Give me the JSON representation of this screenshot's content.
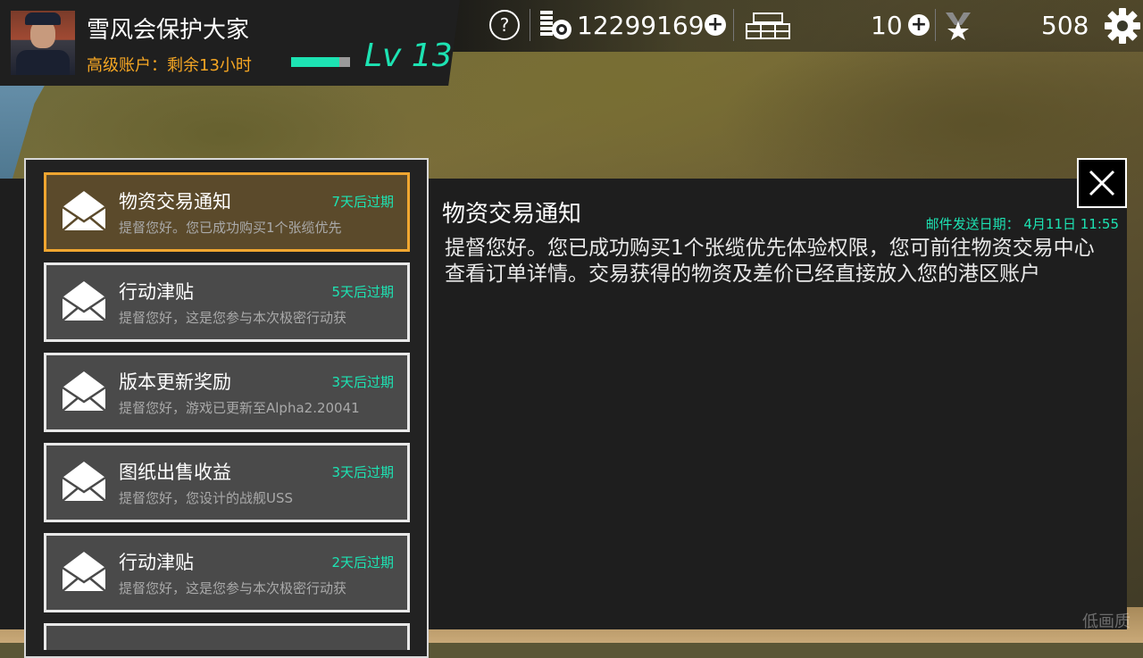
{
  "player": {
    "name": "雪风会保护大家",
    "premium_status": "高级账户：剩余13小时",
    "level_label": "Lv 13",
    "xp_progress": 0.82
  },
  "resources": {
    "coins": "12299169",
    "crates": "10",
    "medals": "508"
  },
  "icons": {
    "help": "question-mark-icon",
    "coins": "coin-stack-icon",
    "crates": "supply-crate-icon",
    "medals": "star-medal-icon",
    "settings": "gear-icon",
    "close": "close-icon",
    "mail": "envelope-icon"
  },
  "colors": {
    "accent_teal": "#1de3b3",
    "premium_orange": "#f5a623",
    "selected_border": "#f0a630"
  },
  "mail_list": [
    {
      "title": "物资交易通知",
      "expire": "7天后过期",
      "preview": "提督您好。您已成功购买1个张缆优先",
      "selected": true
    },
    {
      "title": "行动津贴",
      "expire": "5天后过期",
      "preview": "提督您好，这是您参与本次极密行动获",
      "selected": false
    },
    {
      "title": "版本更新奖励",
      "expire": "3天后过期",
      "preview": "提督您好，游戏已更新至Alpha2.20041",
      "selected": false
    },
    {
      "title": "图纸出售收益",
      "expire": "3天后过期",
      "preview": "提督您好，您设计的战舰USS",
      "selected": false
    },
    {
      "title": "行动津贴",
      "expire": "2天后过期",
      "preview": "提督您好，这是您参与本次极密行动获",
      "selected": false
    }
  ],
  "detail": {
    "title": "物资交易通知",
    "date": "邮件发送日期： 4月11日 11:55",
    "body": "提督您好。您已成功购买1个张缆优先体验权限，您可前往物资交易中心查看订单详情。交易获得的物资及差价已经直接放入您的港区账户"
  },
  "watermark": "低画质"
}
